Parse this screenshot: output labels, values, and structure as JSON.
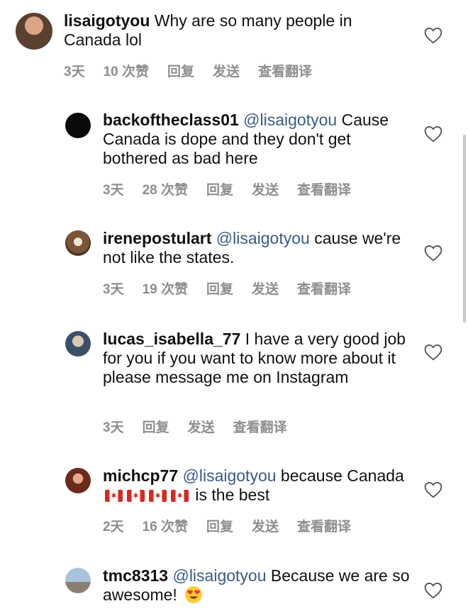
{
  "comments": [
    {
      "user": "lisaigotyou",
      "mention": "",
      "text": "Why are so many people in Canada lol",
      "time": "3天",
      "likes": "10 次赞",
      "reply": "回复",
      "send": "发送",
      "translate": "查看翻译"
    },
    {
      "user": "backoftheclass01",
      "mention": "@lisaigotyou",
      "text": "Cause Canada is dope and they don't get bothered as bad here",
      "time": "3天",
      "likes": "28 次赞",
      "reply": "回复",
      "send": "发送",
      "translate": "查看翻译"
    },
    {
      "user": "irenepostulart",
      "mention": "@lisaigotyou",
      "text": "cause we're not like the states.",
      "time": "3天",
      "likes": "19 次赞",
      "reply": "回复",
      "send": "发送",
      "translate": "查看翻译"
    },
    {
      "user": "lucas_isabella_77",
      "mention": "",
      "text": "I have a very good job for you if you want to know more about it please message me on Instagram",
      "time": "3天",
      "likes": "",
      "reply": "回复",
      "send": "发送",
      "translate": "查看翻译"
    },
    {
      "user": "michcp77",
      "mention": "@lisaigotyou",
      "text_before": "because Canada",
      "text_after": "is the best",
      "time": "2天",
      "likes": "16 次赞",
      "reply": "回复",
      "send": "发送",
      "translate": "查看翻译"
    },
    {
      "user": "tmc8313",
      "mention": "@lisaigotyou",
      "text": "Because we are so awesome!",
      "time": "",
      "likes": "",
      "reply": "",
      "send": "",
      "translate": ""
    }
  ],
  "icons": {
    "like": "heart-outline-icon",
    "flag": "canada-flag-emoji",
    "emoji": "heart-eyes-emoji"
  },
  "colors": {
    "mention": "#3a5a86",
    "meta": "#8e8e8e",
    "flag_red": "#d52b1e"
  }
}
